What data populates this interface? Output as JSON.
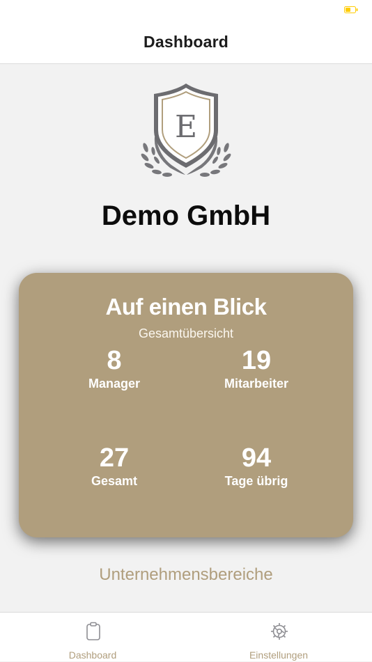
{
  "colors": {
    "accent": "#b09e7d",
    "card_background": "#b09e7d",
    "battery": "#ffcc00",
    "background": "#f2f2f2"
  },
  "status_bar": {
    "battery_icon": "battery-low-charging-icon"
  },
  "nav": {
    "title": "Dashboard"
  },
  "logo": {
    "icon": "company-crest-icon",
    "letter": "E"
  },
  "company": {
    "name": "Demo GmbH"
  },
  "overview": {
    "title": "Auf einen Blick",
    "subtitle": "Gesamtübersicht",
    "stats": [
      {
        "value": "8",
        "label": "Manager"
      },
      {
        "value": "19",
        "label": "Mitarbeiter"
      },
      {
        "value": "27",
        "label": "Gesamt"
      },
      {
        "value": "94",
        "label": "Tage übrig"
      }
    ]
  },
  "sections": {
    "heading": "Unternehmensbereiche"
  },
  "tabs": [
    {
      "label": "Dashboard",
      "icon": "clipboard-icon"
    },
    {
      "label": "Einstellungen",
      "icon": "gear-icon"
    }
  ]
}
